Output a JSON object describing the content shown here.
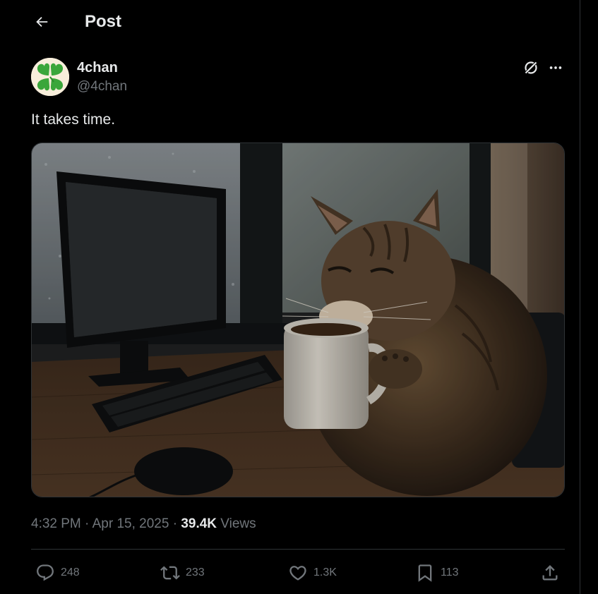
{
  "header": {
    "title": "Post",
    "back_icon": "arrow-left-icon"
  },
  "author": {
    "name": "4chan",
    "handle": "@4chan",
    "avatar_icon": "clover-logo-icon"
  },
  "post": {
    "text": "It takes time.",
    "media_description_icon": "photo-icon"
  },
  "meta": {
    "time": "4:32 PM",
    "separator1": " · ",
    "date": "Apr 15, 2025",
    "separator2": " · ",
    "views_count": "39.4K",
    "views_label": " Views"
  },
  "actions": {
    "replies": "248",
    "reposts": "233",
    "likes": "1.3K",
    "bookmarks": "113"
  },
  "colors": {
    "background": "#000000",
    "primary_text": "#e7e9ea",
    "secondary_text": "#71767b",
    "border": "#2f3336",
    "clover_green": "#3aa63a"
  }
}
